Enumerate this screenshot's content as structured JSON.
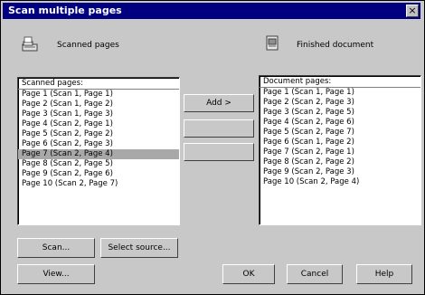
{
  "window": {
    "title": "Scan multiple pages",
    "close_label": "×"
  },
  "scanned": {
    "label": "Scanned pages",
    "list_header": "Scanned pages:",
    "items": [
      "Page 1 (Scan 1, Page 1)",
      "Page 2 (Scan 1, Page 2)",
      "Page 3 (Scan 1, Page 3)",
      "Page 4 (Scan 2, Page 1)",
      "Page 5 (Scan 2, Page 2)",
      "Page 6 (Scan 2, Page 3)",
      "Page 7 (Scan 2, Page 4)",
      "Page 8 (Scan 2, Page 5)",
      "Page 9 (Scan 2, Page 6)",
      "Page 10 (Scan 2, Page 7)"
    ],
    "selected_index": 6
  },
  "finished": {
    "label": "Finished document",
    "list_header": "Document pages:",
    "items": [
      "Page 1 (Scan 1, Page 1)",
      "Page 2 (Scan 2, Page 3)",
      "Page 3 (Scan 2, Page 5)",
      "Page 4 (Scan 2, Page 6)",
      "Page 5 (Scan 2, Page 7)",
      "Page 6 (Scan 1, Page 2)",
      "Page 7 (Scan 2, Page 1)",
      "Page 8 (Scan 2, Page 2)",
      "Page 9 (Scan 2, Page 3)",
      "Page 10 (Scan 2, Page 4)"
    ]
  },
  "buttons": {
    "add": "Add >",
    "remove": "",
    "remove_all": "",
    "scan": "Scan...",
    "select_source": "Select source...",
    "view": "View...",
    "ok": "OK",
    "cancel": "Cancel",
    "help": "Help"
  },
  "icons": {
    "scanned": "scanner-icon",
    "finished": "document-icon"
  }
}
